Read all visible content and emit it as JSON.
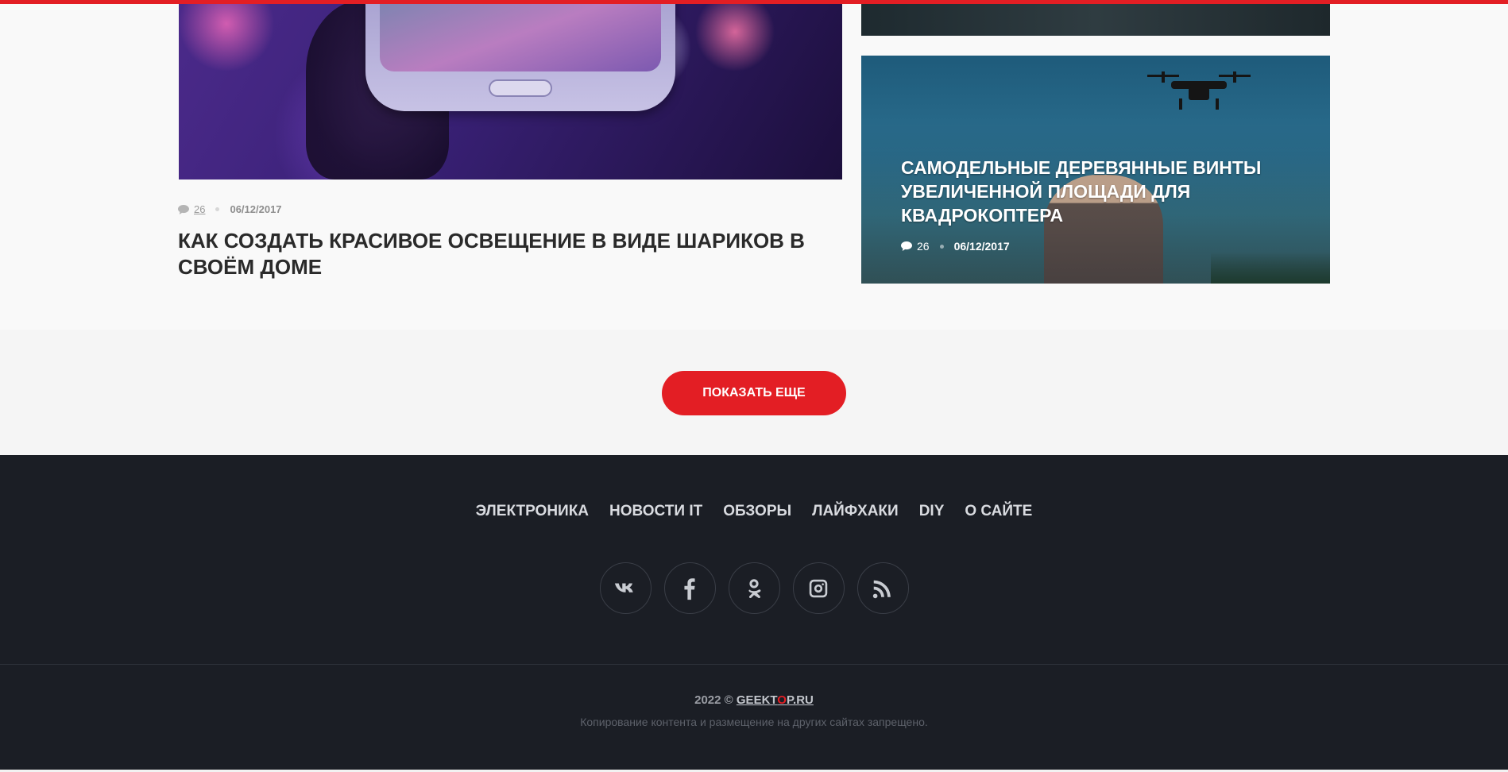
{
  "articles": {
    "left": {
      "comments": "26",
      "date": "06/12/2017",
      "title": "КАК СОЗДАТЬ КРАСИВОЕ ОСВЕЩЕНИЕ В ВИДЕ ШАРИКОВ В СВОЁМ ДОМЕ"
    },
    "right": {
      "comments": "26",
      "date": "06/12/2017",
      "title": "САМОДЕЛЬНЫЕ ДЕРЕВЯННЫЕ ВИНТЫ УВЕЛИЧЕННОЙ ПЛОЩАДИ ДЛЯ КВАДРОКОПТЕРА"
    }
  },
  "more_button": {
    "label": "ПОКАЗАТЬ ЕЩЕ"
  },
  "footer": {
    "nav": [
      {
        "label": "ЭЛЕКТРОНИКА"
      },
      {
        "label": "НОВОСТИ IT"
      },
      {
        "label": "ОБЗОРЫ"
      },
      {
        "label": "ЛАЙФХАКИ"
      },
      {
        "label": "DIY"
      },
      {
        "label": "О САЙТЕ"
      }
    ],
    "social_icons": [
      "vk-icon",
      "facebook-icon",
      "odnoklassniki-icon",
      "instagram-icon",
      "rss-icon"
    ],
    "copyright_year": "2022 ©",
    "brand_prefix": "GEEKT",
    "brand_o": "O",
    "brand_suffix": "P.RU",
    "notice": "Копирование контента и размещение на других сайтах запрещено."
  },
  "colors": {
    "accent": "#e31e24",
    "footer_bg": "#1b1e25"
  }
}
